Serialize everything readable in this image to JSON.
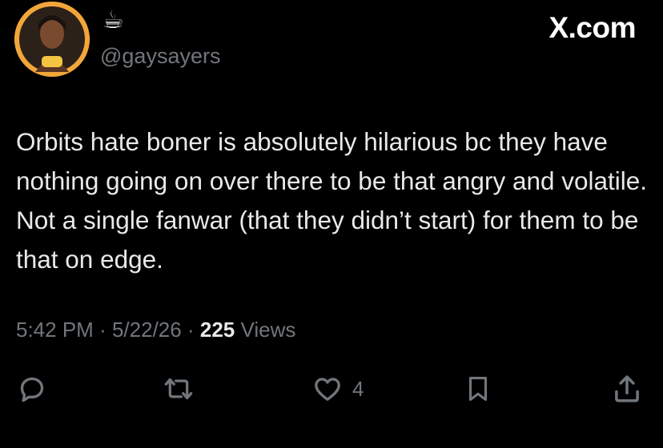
{
  "header": {
    "display_name": "☕",
    "handle": "@gaysayers",
    "brand": "X.com"
  },
  "tweet": {
    "text": "Orbits hate boner is absolutely hilarious bc they have nothing going on over there to be that angry and volatile. Not a single fanwar (that they didn’t start) for them to be that on edge."
  },
  "meta": {
    "time": "5:42 PM",
    "separator": "·",
    "date": "5/22/26",
    "views_count": "225",
    "views_label": "Views"
  },
  "actions": {
    "like_count": "4",
    "icons": [
      "reply-icon",
      "retweet-icon",
      "like-icon",
      "bookmark-icon",
      "share-icon"
    ]
  },
  "colors": {
    "background": "#000000",
    "text_primary": "#e7e9ea",
    "text_secondary": "#71767b",
    "avatar_ring": "#f2a63a"
  }
}
